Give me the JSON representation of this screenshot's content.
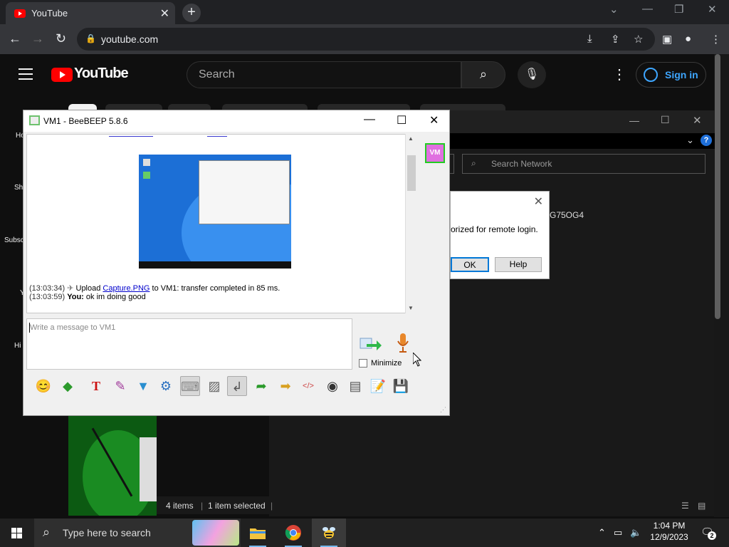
{
  "browser": {
    "tab_title": "YouTube",
    "new_tab": "+",
    "url": "youtube.com"
  },
  "youtube": {
    "logo_text": "YouTube",
    "search_placeholder": "Search",
    "sign_in": "Sign in",
    "sidebar": [
      "Ho",
      "Sh",
      "Subsc",
      "Y",
      "Hi"
    ],
    "icons": [
      "hamburger-menu-icon",
      "search-icon",
      "microphone-icon",
      "more-vert-icon",
      "account-icon"
    ]
  },
  "explorer": {
    "search_placeholder": "Search Network",
    "id_text": "G75OG4",
    "status_items": "4 items",
    "status_selected": "1 item selected"
  },
  "dialog": {
    "message": "orized for remote login.",
    "ok": "OK",
    "help": "Help"
  },
  "beebeep": {
    "title": "VM1 - BeeBEEP 5.8.6",
    "avatar_text": "VM",
    "messages": [
      {
        "time": "(13:03:34)",
        "prefix": "Upload",
        "link": "Capture.PNG",
        "suffix": "to VM1: transfer completed in 85 ms."
      },
      {
        "time": "(13:03:59)",
        "sender": "You:",
        "text": "ok im doing good"
      }
    ],
    "input_placeholder": "Write a message to VM1",
    "minimize_label": "Minimize",
    "toolbar_icons": [
      "emoticon-icon",
      "send-file-icon",
      "font-icon",
      "color-icon",
      "filter-icon",
      "settings-icon",
      "keyboard-icon",
      "spellcheck-icon",
      "compact-icon",
      "send-file-doc-icon",
      "share-folder-icon",
      "code-icon",
      "screenshot-icon",
      "history-icon",
      "edit-icon",
      "save-icon"
    ]
  },
  "taskbar": {
    "search_text": "Type here to search",
    "time": "1:04 PM",
    "date": "12/9/2023",
    "notifications": "2"
  }
}
